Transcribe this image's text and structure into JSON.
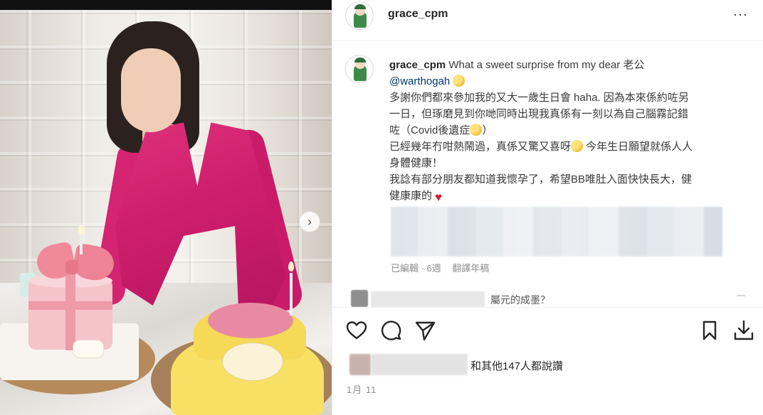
{
  "post": {
    "username": "grace_cpm",
    "caption": {
      "line1_text": " What a sweet surprise from my dear 老公",
      "mention": "@warthogah",
      "line3": "多謝你們都來參加我的又大一歲生日會 haha. 因為本來係約咗另",
      "line4": "一日，但琢磨見到你哋同時出現我真係有一刻以為自己腦霧記錯",
      "line5_a": "咗（Covid後遺症",
      "line5_b": "）",
      "line6_a": "已經幾年冇咁熱鬧過，真係又驚又喜呀",
      "line6_b": " 今年生日願望就係人人",
      "line7": "身體健康！",
      "line8": "我諗有部分朋友都知道我懷孕了，希望BB唯肚入面快快長大，健",
      "line9": "健康康的"
    },
    "meta": {
      "edited": "已編輯 · 6週",
      "translate": "翻譯年稿"
    },
    "comment_preview": "屬元的成墨？",
    "comment_more": "—",
    "likes_text": "和其他147人都說讚",
    "date": "1月 11",
    "more_icon": "···"
  },
  "icons": {
    "avatar": "cartoon-avatar-icon",
    "like": "heart-icon",
    "comment": "comment-bubble-icon",
    "share": "paper-plane-icon",
    "save": "bookmark-icon",
    "download": "download-icon",
    "carousel_next": "chevron-right-icon"
  },
  "colors": {
    "dress": "#d42472",
    "mention": "#00376b",
    "meta": "#8e8e8e",
    "heart_emoji": "#d4213b"
  }
}
